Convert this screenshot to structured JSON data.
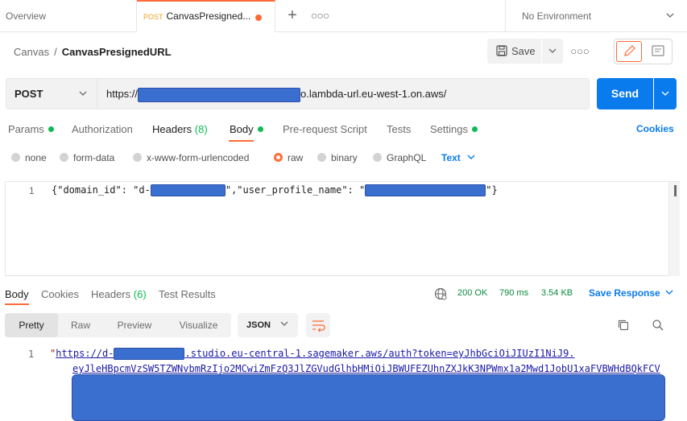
{
  "tabs": {
    "overview": "Overview",
    "active_method": "POST",
    "active_name": "CanvasPresigned...",
    "environment": "No Environment"
  },
  "breadcrumb": {
    "parent": "Canvas",
    "separator": "/",
    "current": "CanvasPresignedURL"
  },
  "toolbar": {
    "save_label": "Save"
  },
  "request": {
    "method": "POST",
    "url_prefix": "https://",
    "url_suffix": "o.lambda-url.eu-west-1.on.aws/",
    "send_label": "Send"
  },
  "request_tabs": [
    {
      "label": "Params",
      "dot": true
    },
    {
      "label": "Authorization"
    },
    {
      "label": "Headers",
      "count": "(8)"
    },
    {
      "label": "Body",
      "active": true
    },
    {
      "label": "Pre-request Script"
    },
    {
      "label": "Tests"
    },
    {
      "label": "Settings",
      "dot": true
    }
  ],
  "cookies_link": "Cookies",
  "body_types": [
    {
      "label": "none"
    },
    {
      "label": "form-data"
    },
    {
      "label": "x-www-form-urlencoded"
    },
    {
      "label": "raw",
      "selected": true
    },
    {
      "label": "binary"
    },
    {
      "label": "GraphQL"
    }
  ],
  "body_format": "Text",
  "editor": {
    "line_number": "1",
    "part1": "{\"domain_id\": \"d-",
    "part2": "\",\"user_profile_name\": \"",
    "part3": "\"}"
  },
  "response_tabs": [
    {
      "label": "Body",
      "active": true
    },
    {
      "label": "Cookies"
    },
    {
      "label": "Headers",
      "count": "(6)"
    },
    {
      "label": "Test Results"
    }
  ],
  "response_meta": {
    "status": "200 OK",
    "time": "790 ms",
    "size": "3.54 KB",
    "save_response": "Save Response"
  },
  "view_modes": [
    "Pretty",
    "Raw",
    "Preview",
    "Visualize"
  ],
  "response_format": "JSON",
  "response_body": {
    "line_number": "1",
    "quote": "\"",
    "link_prefix": "https://d-",
    "link_suffix": ".studio.eu-central-1.sagemaker.aws/auth?token=eyJhbGciOiJIUzI1NiJ9.",
    "line2": "eyJleHBpcmVzSW5TZWNvbmRzIjo2MCwiZmFzQ3JlZGVudGlhbHMiOiJBWUFEZUhnZXJkK3NPWmx1a2Mwd1JobU1xaFVBWHdBQkFCV"
  },
  "colors": {
    "accent": "#ff6c37",
    "primary": "#097bed",
    "success": "#0cbb52",
    "redaction": "#3b6fcf"
  }
}
